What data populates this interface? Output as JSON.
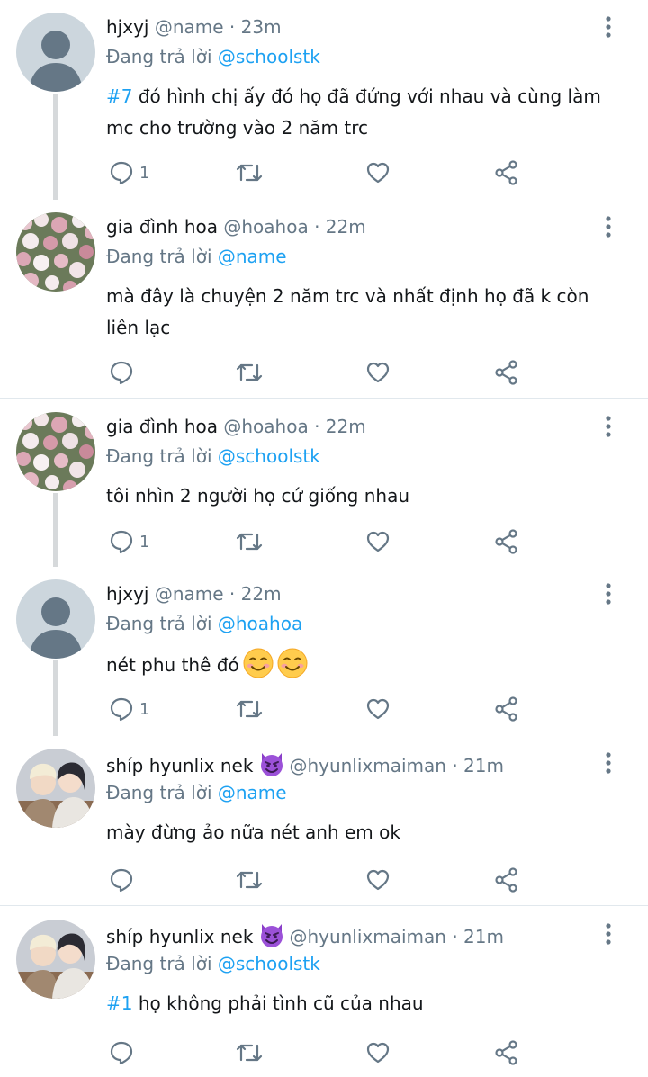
{
  "colors": {
    "accent": "#1da1f2",
    "text": "#14171a",
    "muted": "#657786",
    "divider": "#e1e8ed",
    "thread_line": "#d6d9db"
  },
  "icons": {
    "reply": "comment-icon",
    "retweet": "retweet-icon",
    "like": "heart-icon",
    "share": "share-icon",
    "more": "more-vertical-icon"
  },
  "replying_prefix": "Đang trả lời",
  "tweets": [
    {
      "display": "hjxyj",
      "handle": "@name",
      "time": "· 23m",
      "replying_to": "@schoolstk",
      "tag": "#7",
      "body": " đó hình chị ấy đó họ đã đứng với nhau và cùng làm mc cho trường vào 2 năm trc",
      "reply_count": "1"
    },
    {
      "display": "gia đình hoa",
      "handle": "@hoahoa",
      "time": "· 22m",
      "replying_to": "@name",
      "tag": "",
      "body": "mà đây là chuyện 2 năm trc và nhất định họ đã k còn liên lạc",
      "reply_count": ""
    },
    {
      "display": "gia đình hoa",
      "handle": "@hoahoa",
      "time": "· 22m",
      "replying_to": "@schoolstk",
      "tag": "",
      "body": "tôi nhìn 2 người họ cứ giống nhau",
      "reply_count": "1"
    },
    {
      "display": "hjxyj",
      "handle": "@name",
      "time": "· 22m",
      "replying_to": "@hoahoa",
      "tag": "",
      "body": "nét phu thê đó",
      "reply_count": "1"
    },
    {
      "display": "shíp hyunlix nek",
      "handle": "@hyunlixmaiman",
      "time": "· 21m",
      "replying_to": "@name",
      "tag": "",
      "body": "mày đừng ảo nữa nét anh em ok",
      "reply_count": ""
    },
    {
      "display": "shíp hyunlix nek",
      "handle": "@hyunlixmaiman",
      "time": "· 21m",
      "replying_to": "@schoolstk",
      "tag": "#1",
      "body": " họ không phải tình cũ của nhau",
      "reply_count": ""
    }
  ]
}
